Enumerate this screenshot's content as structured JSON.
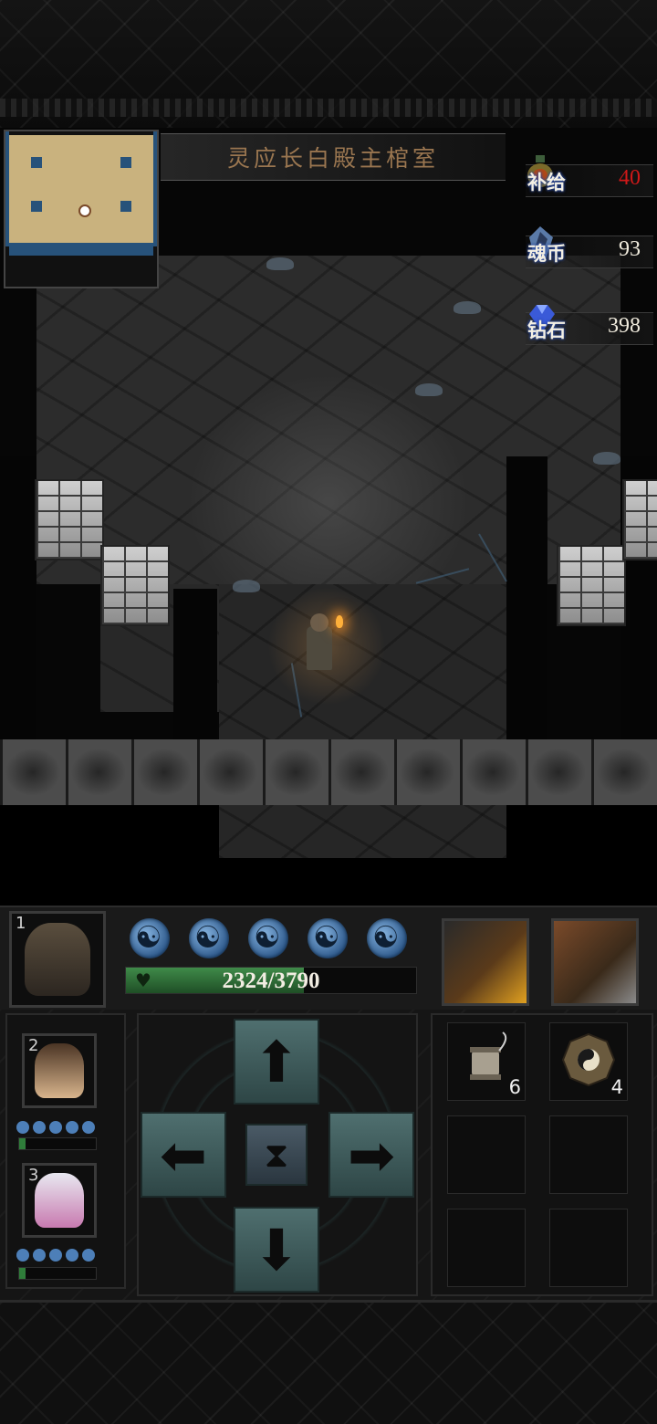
{
  "location": {
    "room_name": "灵应长白殿主棺室"
  },
  "resources": [
    {
      "label": "补给",
      "value": "40",
      "value_color": "#d01818",
      "icon": "supply-bottle-icon"
    },
    {
      "label": "魂币",
      "value": "93",
      "value_color": "#f0ebdd",
      "icon": "soul-coin-icon"
    },
    {
      "label": "钻石",
      "value": "398",
      "value_color": "#f0ebdd",
      "icon": "diamond-icon"
    }
  ],
  "party": {
    "leader": {
      "slot": "1",
      "stamina_orbs": 5,
      "hp_text": "2324/3790",
      "hp_current": 2324,
      "hp_max": 3790
    },
    "members": [
      {
        "slot": "2",
        "stamina_orbs": 5,
        "hp_fraction": 0.08
      },
      {
        "slot": "3",
        "stamina_orbs": 5,
        "hp_fraction": 0.08
      }
    ]
  },
  "skills": [
    {
      "name": "fire-slash-skill-icon"
    },
    {
      "name": "shovel-skill-icon"
    }
  ],
  "controls": {
    "up": "⬆",
    "down": "⬇",
    "left": "⬅",
    "right": "➡",
    "wait": "⧗"
  },
  "inventory": [
    {
      "icon": "thread-spool-icon",
      "qty": "6"
    },
    {
      "icon": "bagua-compass-icon",
      "qty": "4"
    },
    {
      "icon": "empty-slot",
      "qty": ""
    },
    {
      "icon": "empty-slot",
      "qty": ""
    },
    {
      "icon": "empty-slot",
      "qty": ""
    },
    {
      "icon": "empty-slot",
      "qty": ""
    }
  ]
}
